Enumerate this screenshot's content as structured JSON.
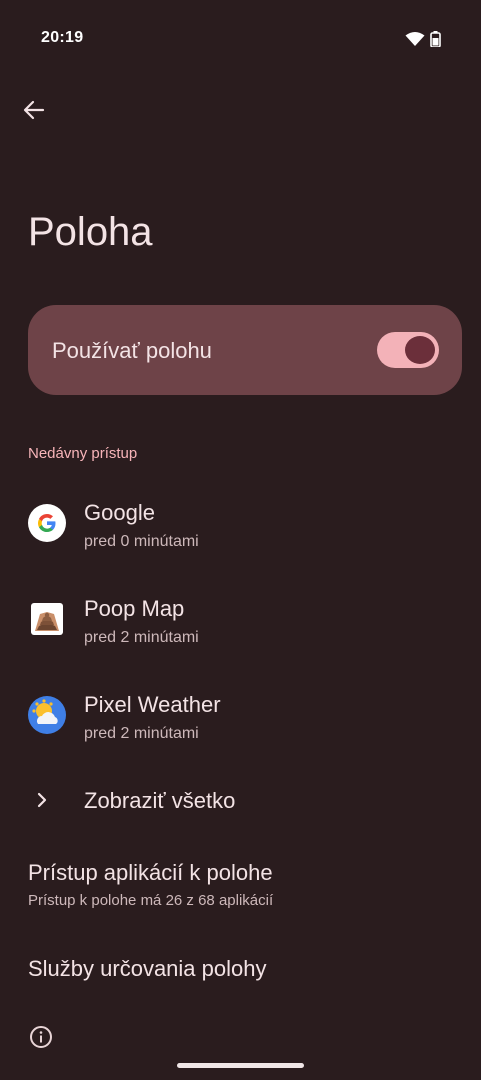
{
  "status_bar": {
    "time": "20:19"
  },
  "header": {
    "title": "Poloha"
  },
  "main_toggle": {
    "label": "Používať polohu",
    "on": true
  },
  "recent": {
    "section_label": "Nedávny prístup",
    "items": [
      {
        "name": "Google",
        "subtitle": "pred 0 minútami",
        "icon": "google-icon"
      },
      {
        "name": "Poop Map",
        "subtitle": "pred 2 minútami",
        "icon": "poop-map-icon"
      },
      {
        "name": "Pixel Weather",
        "subtitle": "pred 2 minútami",
        "icon": "pixel-weather-icon"
      }
    ],
    "see_all_label": "Zobraziť všetko"
  },
  "settings": [
    {
      "title": "Prístup aplikácií k polohe",
      "subtitle": "Prístup k polohe má 26 z 68 aplikácií"
    },
    {
      "title": "Služby určovania polohy"
    }
  ],
  "colors": {
    "background": "#2a1c1e",
    "card": "#6e4348",
    "accent": "#f7b4b9",
    "switch_track": "#f3b2b8",
    "switch_thumb": "#6b2f3a"
  }
}
